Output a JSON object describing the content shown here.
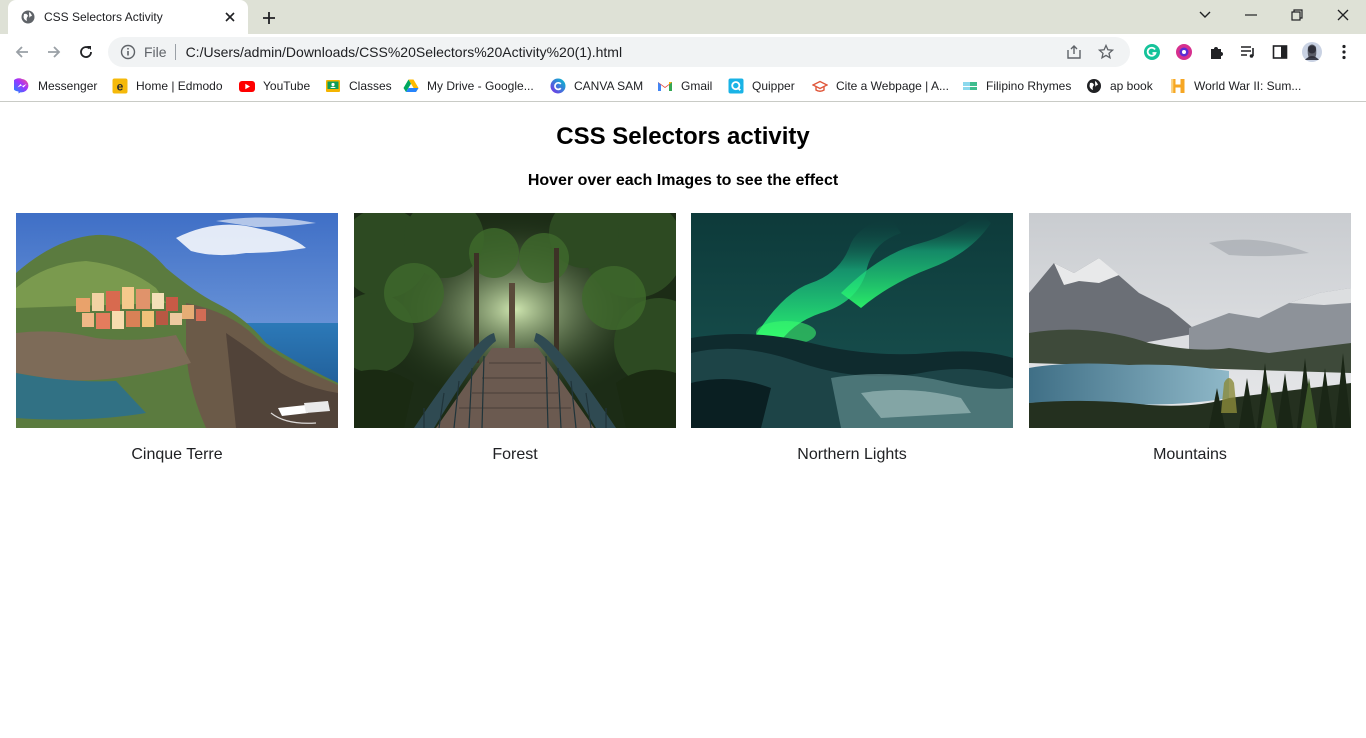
{
  "tab": {
    "title": "CSS Selectors Activity"
  },
  "omnibox": {
    "scheme": "File",
    "url": "C:/Users/admin/Downloads/CSS%20Selectors%20Activity%20(1).html"
  },
  "bookmarks": [
    {
      "label": "Messenger",
      "icon": "messenger-icon"
    },
    {
      "label": "Home | Edmodo",
      "icon": "edmodo-icon"
    },
    {
      "label": "YouTube",
      "icon": "youtube-icon"
    },
    {
      "label": "Classes",
      "icon": "classroom-icon"
    },
    {
      "label": "My Drive - Google...",
      "icon": "google-drive-icon"
    },
    {
      "label": "CANVA SAM",
      "icon": "canva-icon"
    },
    {
      "label": "Gmail",
      "icon": "gmail-icon"
    },
    {
      "label": "Quipper",
      "icon": "quipper-icon"
    },
    {
      "label": "Cite a Webpage | A...",
      "icon": "cite-icon"
    },
    {
      "label": "Filipino Rhymes",
      "icon": "filipino-rhymes-icon"
    },
    {
      "label": "ap book",
      "icon": "globe-icon"
    },
    {
      "label": "World War II: Sum...",
      "icon": "history-icon"
    }
  ],
  "page": {
    "title": "CSS Selectors activity",
    "subtitle": "Hover over each Images to see the effect",
    "gallery": [
      {
        "caption": "Cinque Terre"
      },
      {
        "caption": "Forest"
      },
      {
        "caption": "Northern Lights"
      },
      {
        "caption": "Mountains"
      }
    ]
  }
}
